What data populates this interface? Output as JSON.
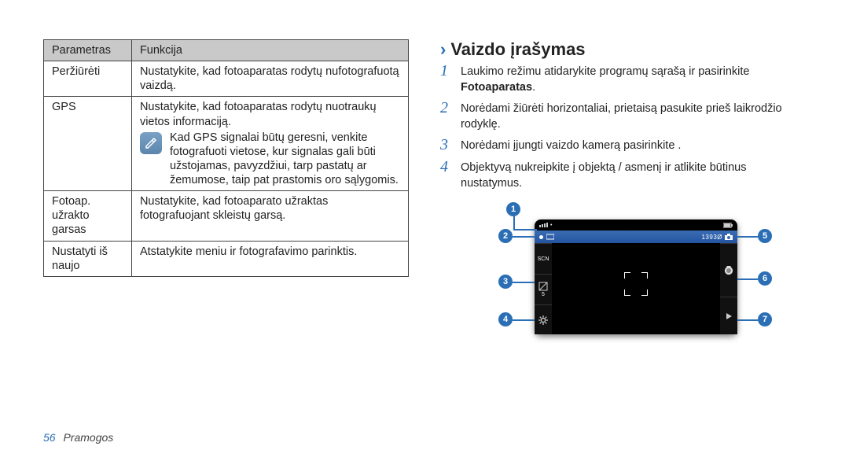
{
  "table": {
    "headers": {
      "param": "Parametras",
      "func": "Funkcija"
    },
    "rows": {
      "review": {
        "param": "Peržiūrėti",
        "func": "Nustatykite, kad fotoaparatas rodytų nufotografuotą vaizdą."
      },
      "gps": {
        "param": "GPS",
        "line1": "Nustatykite, kad fotoaparatas rodytų nuotraukų vietos informaciją.",
        "note": "Kad GPS signalai būtų geresni, venkite fotografuoti vietose, kur signalas gali būti užstojamas, pavyzdžiui, tarp pastatų ar žemumose, taip pat prastomis oro sąlygomis."
      },
      "shutter": {
        "param": "Fotoap. užrakto garsas",
        "func": "Nustatykite, kad fotoaparato užraktas fotografuojant skleistų garsą."
      },
      "reset": {
        "param": "Nustatyti iš naujo",
        "func": "Atstatykite meniu ir fotografavimo parinktis."
      }
    }
  },
  "section": {
    "title": "Vaizdo įrašymas",
    "steps": {
      "s1a": "Laukimo režimu atidarykite programų sąrašą ir pasirinkite ",
      "s1b": "Fotoaparatas",
      "s1c": ".",
      "s2": "Norėdami žiūrėti horizontaliai, prietaisą pasukite prieš laikrodžio rodyklę.",
      "s3": "Norėdami įjungti vaizdo kamerą pasirinkite       .",
      "s4": "Objektyvą nukreipkite į objektą / asmenį ir atlikite būtinus nustatymus."
    }
  },
  "diagram": {
    "callouts": {
      "c1": "1",
      "c2": "2",
      "c3": "3",
      "c4": "4",
      "c5": "5",
      "c6": "6",
      "c7": "7"
    },
    "screen": {
      "time": "1393Ø",
      "scn": "SCN",
      "ev_val": "5"
    }
  },
  "footer": {
    "page": "56",
    "label": "Pramogos"
  }
}
